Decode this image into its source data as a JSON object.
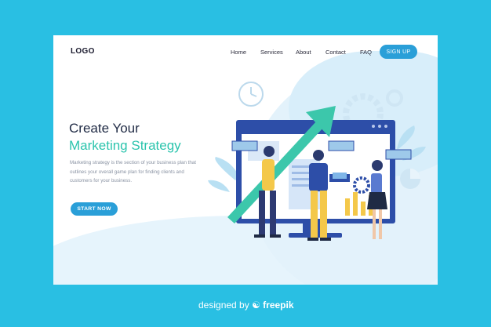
{
  "header": {
    "logo": "LOGO",
    "nav": [
      "Home",
      "Services",
      "About",
      "Contact",
      "FAQ"
    ],
    "signup_label": "SIGN UP"
  },
  "hero": {
    "title_line1": "Create Your",
    "title_line2": "Marketing Strategy",
    "description": "Marketing strategy is the section of your business plan that outlines your overall game plan for finding clients and customers for your business.",
    "cta_label": "START NOW"
  },
  "footer": {
    "credit_prefix": "designed by",
    "credit_brand": "freepik"
  },
  "colors": {
    "page_bg": "#29bfe3",
    "accent": "#2a9fd8",
    "title_dark": "#1f2a44",
    "title_teal": "#2bc4ad"
  },
  "icons": [
    "clock-icon",
    "gear-icon",
    "pie-chart-icon",
    "growth-arrow-icon",
    "freepik-logo-icon"
  ]
}
